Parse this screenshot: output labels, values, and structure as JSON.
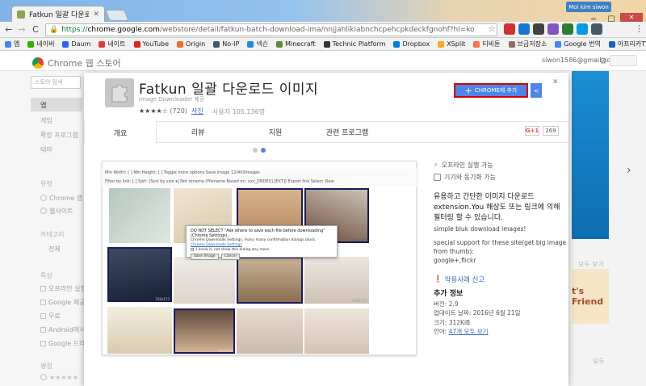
{
  "browser": {
    "tab_title": "Fatkun 일괄 다운로드 이",
    "tab_close": "✕",
    "user_name": "Moi kim siwon",
    "win_min": "─",
    "win_max": "☐",
    "win_close": "✕",
    "url_secure": "https://",
    "url_host": "chrome.google.com",
    "url_path": "/webstore/detail/fatkun-batch-download-ima/nnjjahlikiabnchcpehcpkdeckfgnohf?hl=ko",
    "back": "←",
    "forward": "→",
    "reload": "C",
    "star": "☆",
    "menu": "⋮",
    "ext_colors": [
      "#d32f2f",
      "#1976d2",
      "#424242",
      "#7e57c2",
      "#2e7d32",
      "#039be5",
      "#455a64"
    ]
  },
  "bookmarks": [
    {
      "label": "앱",
      "color": "#4285f4"
    },
    {
      "label": "네이버",
      "color": "#2db400"
    },
    {
      "label": "Daum",
      "color": "#2962ff"
    },
    {
      "label": "네이트",
      "color": "#e53935"
    },
    {
      "label": "YouTube",
      "color": "#e62117"
    },
    {
      "label": "Origin",
      "color": "#f56c2d"
    },
    {
      "label": "No-IP",
      "color": "#455a64"
    },
    {
      "label": "넥슨",
      "color": "#1e88e5"
    },
    {
      "label": "Minecraft",
      "color": "#5d8a3a"
    },
    {
      "label": "Technic Platform",
      "color": "#333333"
    },
    {
      "label": "Dropbox",
      "color": "#007ee5"
    },
    {
      "label": "XSplit",
      "color": "#f9a825"
    },
    {
      "label": "티비툰",
      "color": "#ff7043"
    },
    {
      "label": "브금저장소",
      "color": "#8d6e63"
    },
    {
      "label": "Google 번역",
      "color": "#4285f4"
    },
    {
      "label": "아프리카TV",
      "color": "#1565c0"
    }
  ],
  "store": {
    "title": "Chrome 웹 스토어",
    "account": "siwon1586@gmail.com",
    "account_caret": "▾",
    "gear": "⚙",
    "search_placeholder": "스토어 검색",
    "nav": [
      "앱",
      "게임",
      "확장 프로그램",
      "테마"
    ],
    "type_heading": "유형",
    "types": [
      "Chrome 앱",
      "웹사이트"
    ],
    "category_heading": "카테고리",
    "category_value": "전체",
    "feature_heading": "특성",
    "features": [
      "오프라인 실행",
      "Google 제공",
      "무료",
      "Android에서",
      "Google 드라이브"
    ],
    "rating_heading": "평점",
    "rating_stars": "★★★★★",
    "right_more1": "모두 보기",
    "right_tile_text": "t's Friend",
    "right_more2": "모두",
    "scroll_arrow": "›"
  },
  "extension": {
    "name": "Fatkun 일괄 다운로드 이미지",
    "offered_by": "Image Downloader 제공",
    "stars": "★★★★☆",
    "rating_count": "(720)",
    "photo_link": "사진",
    "users": "사용자 105,136명",
    "add_button": "CHROME에 추가",
    "add_plus": "+",
    "share_icon": "<",
    "close": "✕",
    "tabs": [
      "개요",
      "리뷰",
      "지원",
      "관련 프로그램"
    ],
    "gplus": "G+1",
    "gplus_count": "269",
    "features": [
      "오프라인 실행 가능",
      "기기와 동기화 가능"
    ],
    "description": "유용하고 간단한 이미지 다운로드 extension.You 해상도 또는 링크에 의해 필터링 할 수 있습니다.",
    "desc_lines": [
      "simple bluk download images!",
      "special support for these site(get big image from thumb):",
      "google+,flickr"
    ],
    "report": "악용사례 신고",
    "info_title": "추가 정보",
    "version_label": "버전: 2.9",
    "updated_label": "업데이트 날짜: 2016년 6월 21일",
    "size_label": "크기: 312KiB",
    "language_prefix": "언어: ",
    "language_link": "47개 모두 보기"
  },
  "screenshot": {
    "toolbar1": "Min Width: [    ]   Min Height: [    ]   Toggle   more options   Save image   12/400images",
    "toolbar2": "Filter by link: [                ]   Sort: [Sort by size ▾]   Not rename   (Filename Based on: xxx_[INDEX].[EXT])   Export link   Select View",
    "popup_title": "DO NOT SELECT \"Ask where to save each file before downloading\" (Chrome Settings).",
    "popup_body": "Chrome Downloads Settings, many many confirmation dialogs block.",
    "popup_link": "Chrome Downloads Settings",
    "popup_check": "I know it, not show this dialog any more.",
    "popup_save": "Save Image",
    "popup_cancel": "Cancel",
    "size1": "330x440",
    "size2": "330x173",
    "size3": "330x173",
    "size4": "330x173"
  }
}
